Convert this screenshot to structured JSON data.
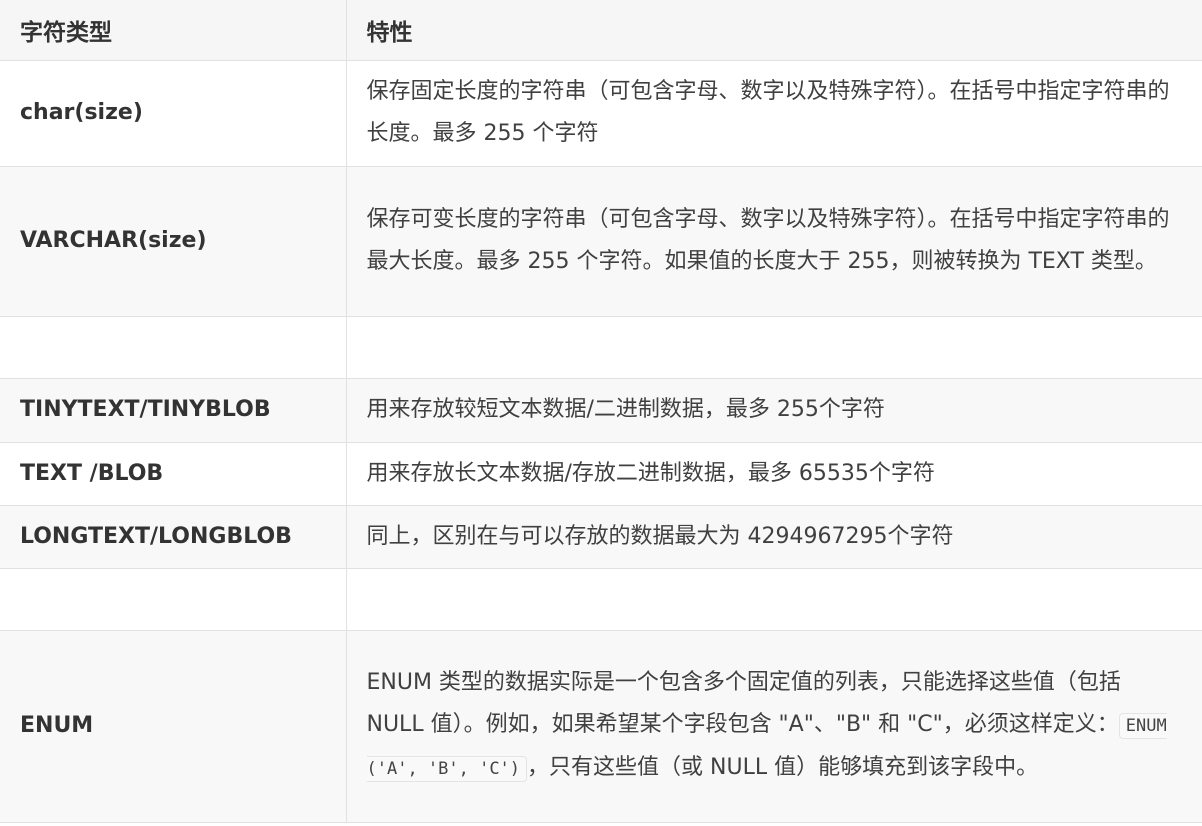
{
  "header": {
    "col_type": "字符类型",
    "col_desc": "特性"
  },
  "rows": [
    {
      "name": "char(size)",
      "desc": "保存固定长度的字符串（可包含字母、数字以及特殊字符）。在括号中指定字符串的长度。最多 255 个字符"
    },
    {
      "name": "VARCHAR(size)",
      "desc": "保存可变长度的字符串（可包含字母、数字以及特殊字符）。在括号中指定字符串的最大长度。最多 255 个字符。如果值的长度大于 255，则被转换为 TEXT 类型。"
    },
    {
      "name": "",
      "desc": ""
    },
    {
      "name": "TINYTEXT/TINYBLOB",
      "desc": "用来存放较短文本数据/二进制数据，最多  255个字符"
    },
    {
      "name": "TEXT /BLOB",
      "desc": "用来存放长文本数据/存放二进制数据，最多 65535个字符"
    },
    {
      "name": "LONGTEXT/LONGBLOB",
      "desc": "同上，区别在与可以存放的数据最大为 4294967295个字符"
    },
    {
      "name": "",
      "desc": ""
    },
    {
      "name": "ENUM",
      "desc_before": " ENUM 类型的数据实际是一个包含多个固定值的列表，只能选择这些值（包括 NULL 值）。例如，如果希望某个字段包含 \"A\"、\"B\" 和 \"C\"，必须这样定义：",
      "desc_code": "ENUM ('A', 'B', 'C')",
      "desc_after": "，只有这些值（或 NULL 值）能够填充到该字段中。"
    }
  ]
}
